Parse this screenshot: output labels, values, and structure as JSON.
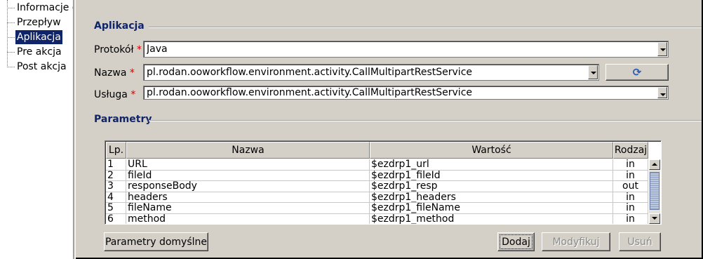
{
  "tree": {
    "items": [
      "Informacje o",
      "Przepływ",
      "Aplikacja",
      "Pre akcja",
      "Post akcja"
    ],
    "selected": "Aplikacja"
  },
  "application": {
    "section_title": "Aplikacja",
    "protocol_label": "Protokół",
    "protocol_value": "Java",
    "name_label": "Nazwa",
    "name_value": "pl.rodan.ooworkflow.environment.activity.CallMultipartRestService",
    "service_label": "Usługa",
    "service_value": "pl.rodan.ooworkflow.environment.activity.CallMultipartRestService",
    "required_mark": "*",
    "refresh_icon": "refresh-icon"
  },
  "parameters": {
    "section_title": "Parametry",
    "columns": [
      "Lp.",
      "Nazwa",
      "Wartość",
      "Rodzaj"
    ],
    "rows": [
      [
        "1",
        "URL",
        "$ezdrp1_url",
        "in"
      ],
      [
        "2",
        "fileId",
        "$ezdrp1_fileId",
        "in"
      ],
      [
        "3",
        "responseBody",
        "$ezdrp1_resp",
        "out"
      ],
      [
        "4",
        "headers",
        "$ezdrp1_headers",
        "in"
      ],
      [
        "5",
        "fileName",
        "$ezdrp1_fileName",
        "in"
      ],
      [
        "6",
        "method",
        "$ezdrp1_method",
        "in"
      ]
    ]
  },
  "buttons": {
    "defaults": "Parametry domyślne",
    "add": "Dodaj",
    "modify": "Modyfikuj",
    "remove": "Usuń"
  },
  "colors": {
    "selection": "#10246a",
    "section_title": "#10246a",
    "required": "#d00000",
    "panel": "#d4d0c8"
  }
}
